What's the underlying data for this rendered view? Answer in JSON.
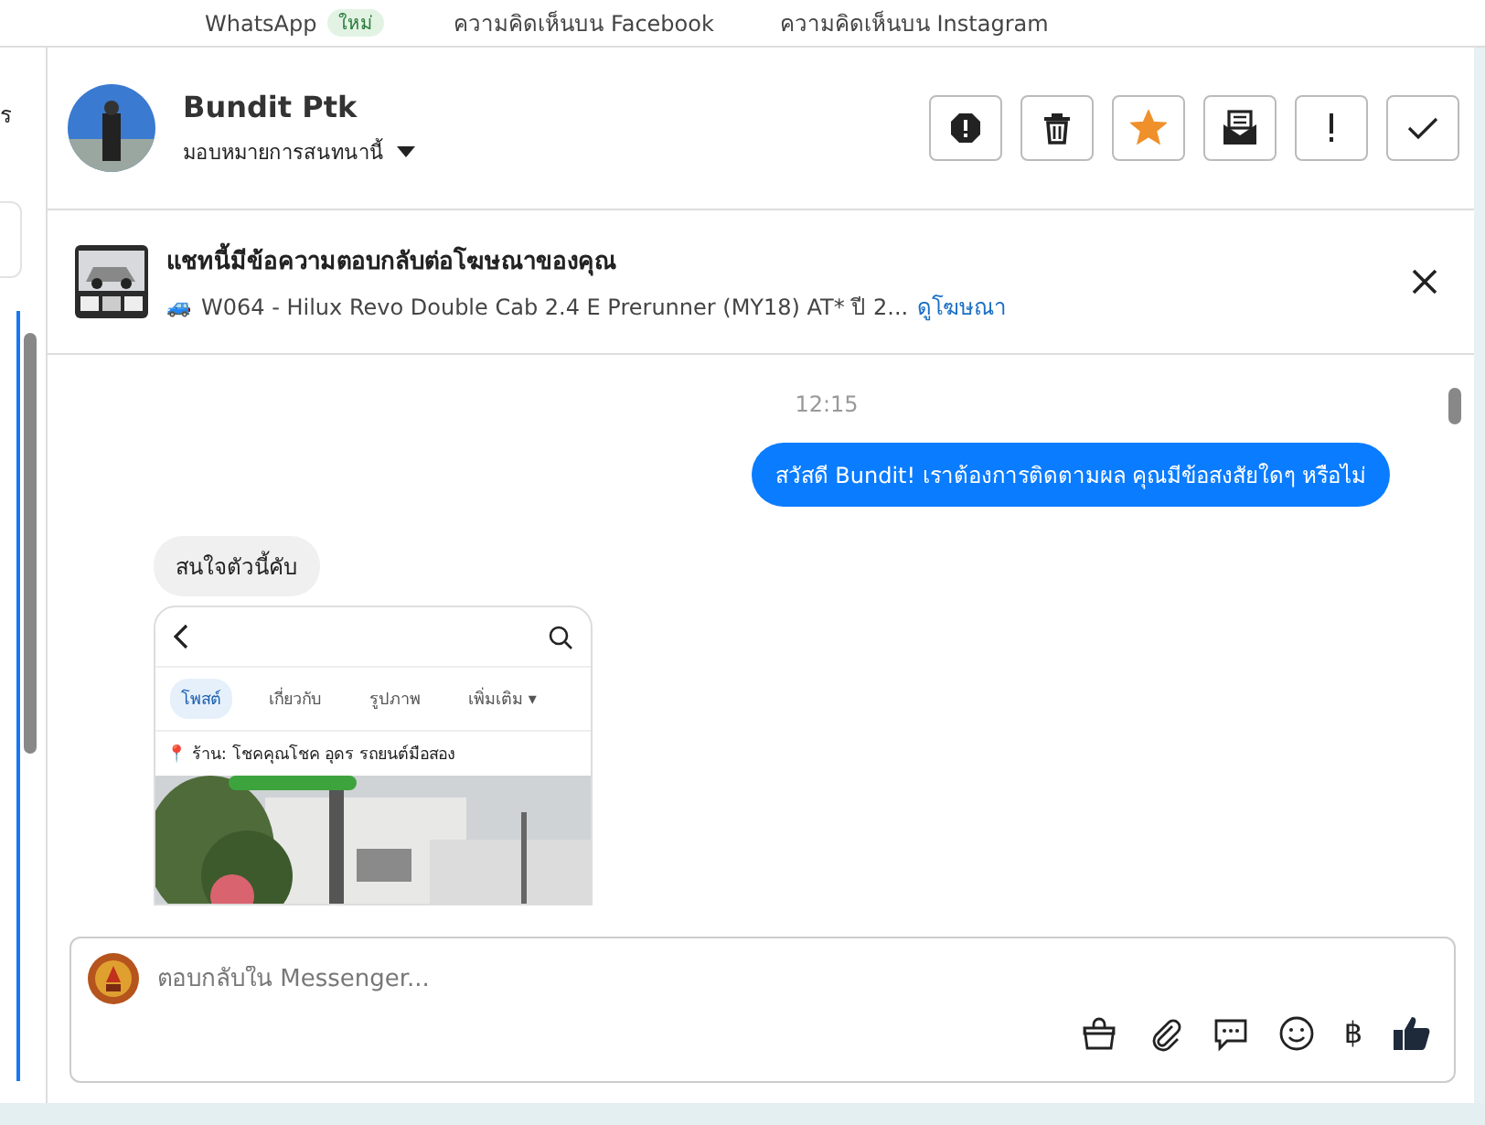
{
  "top_tabs": [
    {
      "label": "WhatsApp",
      "badge": "ใหม่"
    },
    {
      "label": "ความคิดเห็นบน Facebook"
    },
    {
      "label": "ความคิดเห็นบน Instagram"
    }
  ],
  "left_fragment": "ร",
  "contact": {
    "name": "Bundit Ptk",
    "assign": "มอบหมายการสนทนานี้"
  },
  "actions": [
    {
      "kind": "alert"
    },
    {
      "kind": "trash"
    },
    {
      "kind": "star",
      "on": true
    },
    {
      "kind": "mail"
    },
    {
      "kind": "important"
    },
    {
      "kind": "done"
    }
  ],
  "ad": {
    "title": "แชทนี้มีข้อความตอบกลับต่อโฆษณาของคุณ",
    "emoji": "🚙",
    "subtitle": "W064 - Hilux Revo Double Cab 2.4 E Prerunner (MY18) AT* ปี 2...",
    "link": "ดูโฆษณา"
  },
  "messages": [
    {
      "kind": "time",
      "text": "12:15"
    },
    {
      "kind": "out",
      "text": "สวัสดี Bundit! เราต้องการติดตามผล คุณมีข้อสงสัยใดๆ หรือไม่"
    },
    {
      "kind": "in",
      "text": "สนใจตัวนี้คับ"
    },
    {
      "kind": "screenshot",
      "tabs": [
        {
          "label": "โพสต์",
          "selected": true
        },
        {
          "label": "เกี่ยวกับ",
          "selected": false
        },
        {
          "label": "รูปภาพ",
          "selected": false
        },
        {
          "label": "เพิ่มเติม ▾",
          "selected": false
        }
      ],
      "location": "📍 ร้าน: โชคคุณโชค อุดร รถยนต์มือสอง"
    }
  ],
  "composer": {
    "placeholder": "ตอบกลับใน Messenger...",
    "tools": [
      {
        "kind": "bag"
      },
      {
        "kind": "clip"
      },
      {
        "kind": "chat"
      },
      {
        "kind": "smile"
      },
      {
        "kind": "baht",
        "text": "฿"
      },
      {
        "kind": "like"
      }
    ]
  }
}
